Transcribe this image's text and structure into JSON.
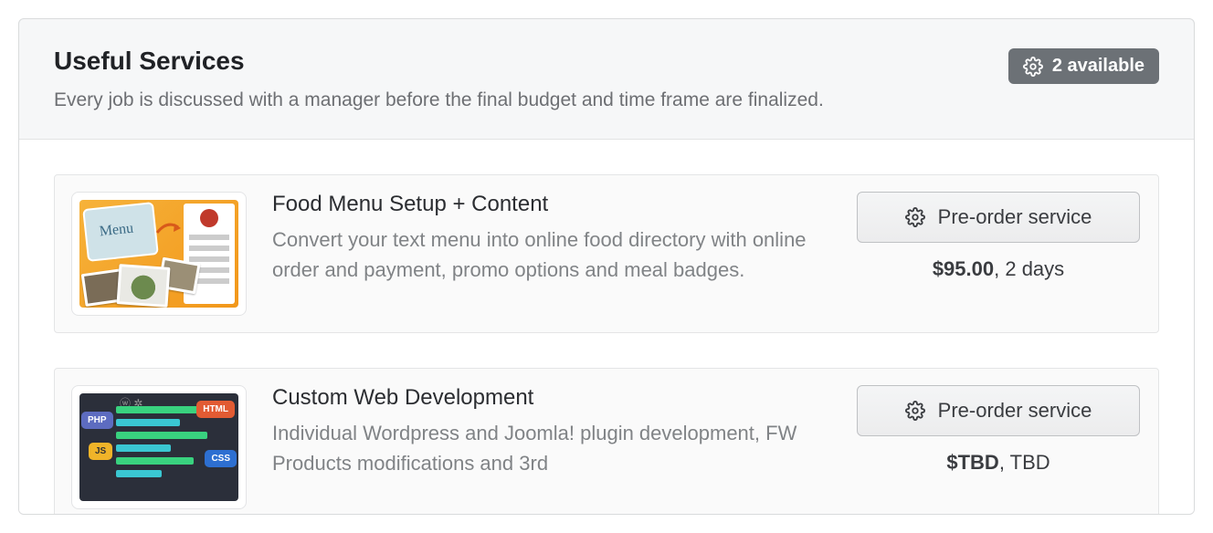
{
  "header": {
    "title": "Useful Services",
    "subtitle": "Every job is discussed with a manager before the final budget and time frame are finalized."
  },
  "availability_badge": {
    "icon": "gear-icon",
    "label": "2 available"
  },
  "preorder_label": "Pre-order service",
  "services": [
    {
      "title": "Food Menu Setup + Content",
      "description": "Convert your text menu into online food directory with online order and payment, promo options and meal badges.",
      "price": "$95.00",
      "duration": "2 days",
      "thumb": "food"
    },
    {
      "title": "Custom Web Development",
      "description": "Individual Wordpress and Joomla! plugin development, FW Products modifications and 3rd",
      "price": "$TBD",
      "duration": "TBD",
      "thumb": "dev"
    }
  ]
}
